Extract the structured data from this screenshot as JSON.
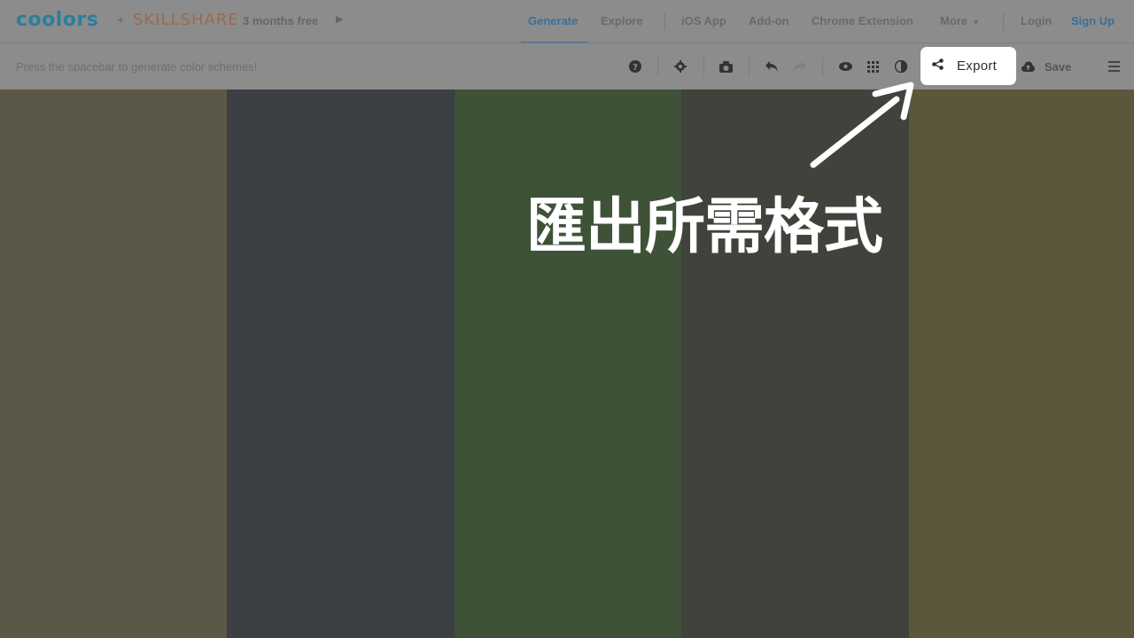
{
  "header": {
    "logo": "coolors",
    "plus": "+",
    "partner": "SKILLSHARE",
    "promo": "3 months free",
    "nav": [
      {
        "label": "Generate"
      },
      {
        "label": "Explore"
      },
      {
        "label": "iOS App"
      },
      {
        "label": "Add-on"
      },
      {
        "label": "Chrome Extension"
      },
      {
        "label": "More"
      },
      {
        "label": "Login"
      },
      {
        "label": "Sign Up"
      }
    ]
  },
  "toolbar": {
    "hint": "Press the spacebar to generate color schemes!",
    "icons": [
      "help-icon",
      "settings-icon",
      "camera-icon",
      "undo-icon",
      "redo-icon",
      "view-icon",
      "grid-icon",
      "contrast-icon",
      "share-icon",
      "cloud-icon",
      "menu-icon"
    ],
    "export_label": "Export",
    "save_label": "Save"
  },
  "palette": {
    "colors": [
      "#5b5848",
      "#3c4044",
      "#3e5237",
      "#40433b",
      "#5c573b"
    ]
  },
  "callout": {
    "text": "匯出所需格式"
  }
}
